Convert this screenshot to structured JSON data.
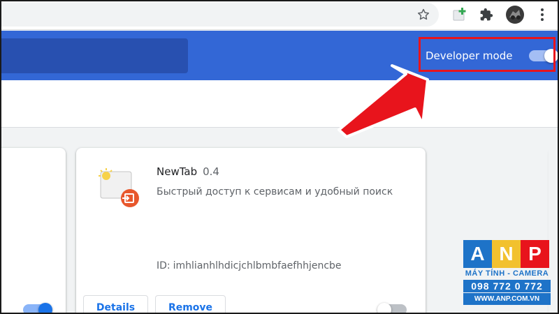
{
  "browser": {
    "toolbar_icons": [
      "star-icon",
      "extension-add-icon",
      "puzzle-icon",
      "profile-avatar",
      "kebab-menu-icon"
    ]
  },
  "header": {
    "developer_mode_label": "Developer mode",
    "developer_mode_on": true
  },
  "extension": {
    "name": "NewTab",
    "version": "0.4",
    "description": "Быстрый доступ к сервисам и удобный поиск",
    "id_label": "ID:",
    "id_value": "imhlianhlhdicjchlbmbfaefhhjencbe",
    "details_label": "Details",
    "remove_label": "Remove",
    "enabled": false
  },
  "left_card": {
    "enabled": true
  },
  "annotation": {
    "highlight_color": "#e8141c",
    "arrow_color": "#e8141c"
  },
  "watermark": {
    "letters": [
      "A",
      "N",
      "P"
    ],
    "letter_colors": [
      "#1e73c8",
      "#f2c12e",
      "#e8141c"
    ],
    "subtitle": "MÁY TÍNH - CAMERA",
    "phone": "098 772 0 772",
    "url": "WWW.ANP.COM.VN"
  },
  "colors": {
    "accent": "#3367d6",
    "link": "#1a73e8"
  }
}
